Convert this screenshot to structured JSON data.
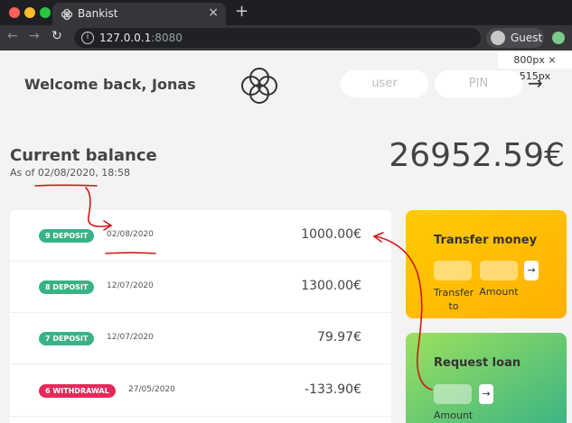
{
  "browser": {
    "tab_title": "Bankist",
    "tab_close": "×",
    "new_tab": "+",
    "back": "←",
    "forward": "→",
    "reload": "↻",
    "url_host": "127.0.0.1",
    "url_port": ":8080",
    "profile_label": "Guest",
    "viewport_badge": "800px × 515px"
  },
  "app": {
    "welcome": "Welcome back, Jonas",
    "login": {
      "user_placeholder": "user",
      "pin_placeholder": "PIN",
      "button": "→"
    },
    "balance": {
      "label": "Current balance",
      "date_prefix": "As of ",
      "date": "02/08/2020",
      "time": ", 18:58",
      "value": "26952.59€"
    },
    "movements": [
      {
        "type": "9 DEPOSIT",
        "kind": "deposit",
        "date": "02/08/2020",
        "value": "1000.00€"
      },
      {
        "type": "8 DEPOSIT",
        "kind": "deposit",
        "date": "12/07/2020",
        "value": "1300.00€"
      },
      {
        "type": "7 DEPOSIT",
        "kind": "deposit",
        "date": "12/07/2020",
        "value": "79.97€"
      },
      {
        "type": "6 WITHDRAWAL",
        "kind": "withdrawal",
        "date": "27/05/2020",
        "value": "-133.90€"
      }
    ],
    "transfer": {
      "title": "Transfer money",
      "button": "→",
      "label_to": "Transfer to",
      "label_amount": "Amount"
    },
    "loan": {
      "title": "Request loan",
      "button": "→",
      "label_amount": "Amount"
    }
  },
  "colors": {
    "deposit": "#39b385",
    "withdrawal": "#e52a5a",
    "transfer_bg": "#ffb003",
    "loan_bg": "#39b385",
    "annotation": "#d01818"
  }
}
